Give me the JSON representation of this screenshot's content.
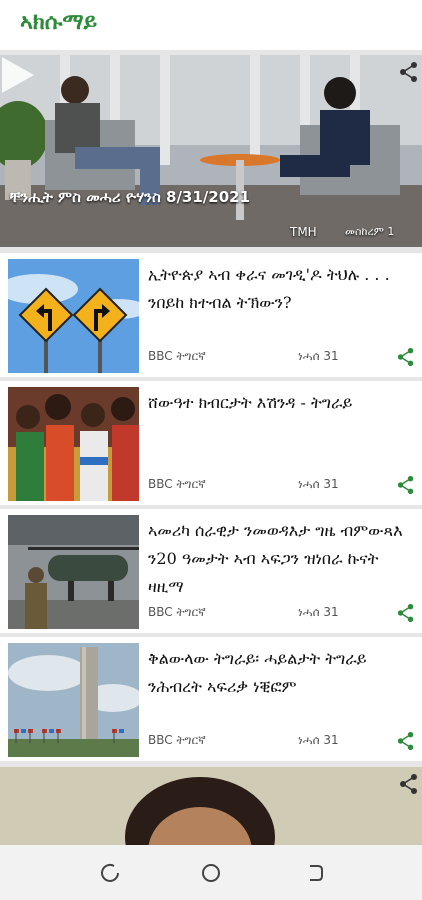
{
  "app": {
    "title": "ኣክሱማይ"
  },
  "featured": {
    "title": "ቸንሒት ምስ መሓሪ ዮሃንስ 8/31/2021",
    "source": "TMH",
    "date": "መስከረም 1",
    "icons": {
      "play": "play-icon",
      "share": "share-icon"
    }
  },
  "articles": [
    {
      "title": "ኢትዮጵያ ኣብ ቀራና መገዲ'ዶ ትህሉ . . . ንበይከ ክተብል ትኽውን?",
      "source": "BBC ትግርኛ",
      "date": "ነሓሰ 31",
      "image": "road-signs-image"
    },
    {
      "title": "ሸውዓተ ክብርታት እሽንዳ - ትግራይ",
      "source": "BBC ትግርኛ",
      "date": "ነሓሰ 31",
      "image": "ashenda-girls-image"
    },
    {
      "title": "ኣመሪካ ሰራዊታ ንመወዳእታ ግዜ ብምውጻእ ን20 ዓመታት ኣብ ኣፍጋን ዝነበራ ኩናት ዛዚማ",
      "source": "BBC ትግርኛ",
      "date": "ነሓሰ 31",
      "image": "helicopter-soldier-image"
    },
    {
      "title": "ቅልውላው ትግራይ፡ ሓይልታት ትግራይ ንሕብረት ኣፍሪቃ ነቒፎም",
      "source": "BBC ትግርኛ",
      "date": "ነሓሰ 31",
      "image": "au-building-image"
    }
  ],
  "colors": {
    "accent": "#2e8b3a",
    "background": "#e6e6e6"
  },
  "navbar": {
    "icons": [
      "recent-apps-icon",
      "home-icon",
      "back-icon"
    ]
  }
}
